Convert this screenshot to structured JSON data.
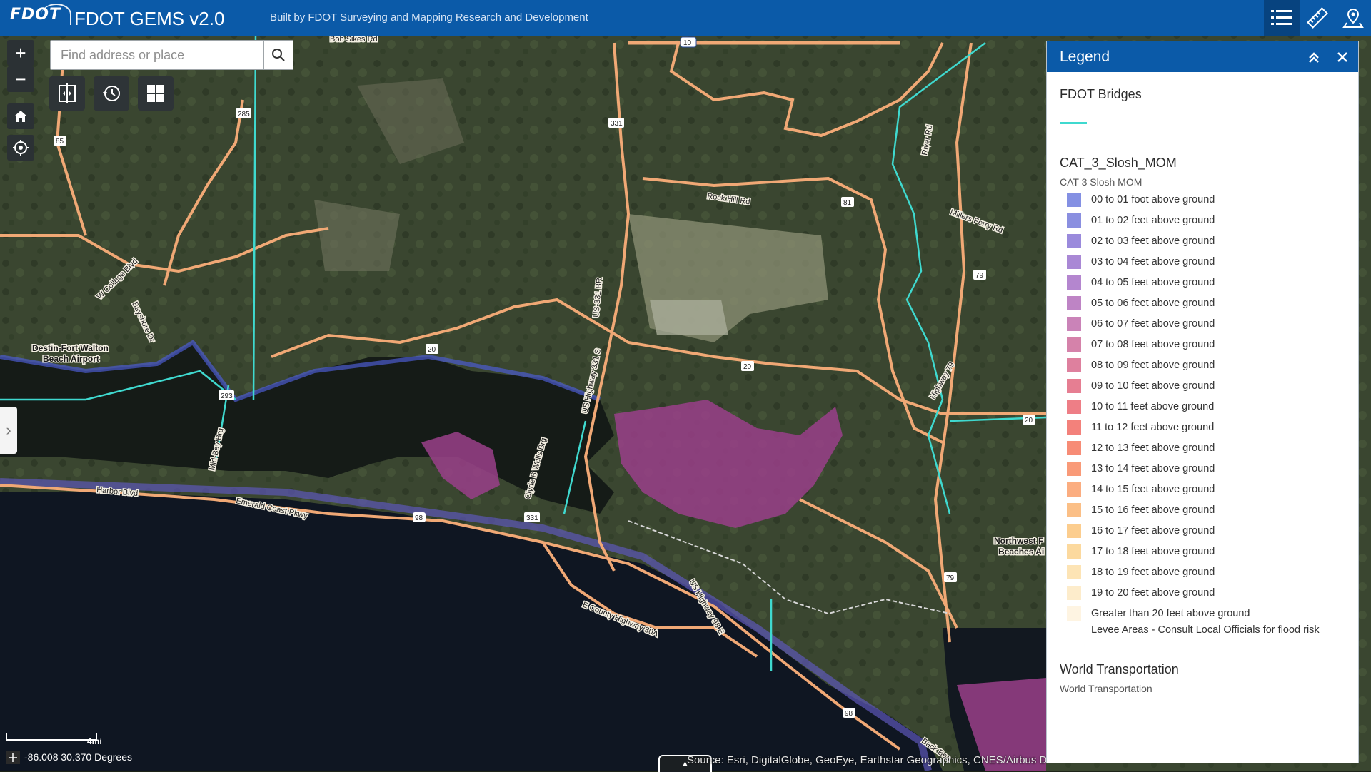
{
  "header": {
    "logo_text": "FDOT",
    "app_title": "FDOT GEMS v2.0",
    "subtitle": "Built by FDOT Surveying and Mapping Research and Development",
    "buttons": [
      {
        "name": "legend-list",
        "icon": "list-icon"
      },
      {
        "name": "measure",
        "icon": "ruler-icon"
      },
      {
        "name": "location",
        "icon": "map-pin-icon"
      }
    ]
  },
  "search": {
    "placeholder": "Find address or place"
  },
  "map_controls": {
    "zoom_in": "+",
    "zoom_out": "−",
    "home": "home-icon",
    "locate": "locate-icon",
    "tools": [
      "swipe-compare-icon",
      "history-icon",
      "basemap-gallery-icon"
    ]
  },
  "map_labels": {
    "places": [
      "Destin-Fort Walton",
      "Beach Airport",
      "Northwest F",
      "Beaches Ai"
    ],
    "roads": [
      "Bob Sikes Rd",
      "Rock Hill Rd",
      "Millers Ferry Rd",
      "River Rd",
      "US-331 BR",
      "US Highway 331 S",
      "Highway 79",
      "Mid-Bay Brg",
      "Clyde B Wells Brg",
      "Emerald Coast Pkwy",
      "Harbor Blvd",
      "E County Highway 30A",
      "US Highway 98 E",
      "W College Blvd",
      "Bayshore Dr",
      "Back Bea"
    ],
    "shields": [
      "10",
      "285",
      "85",
      "331",
      "81",
      "79",
      "20",
      "20",
      "20",
      "293",
      "98",
      "331",
      "79",
      "98"
    ]
  },
  "legend": {
    "title": "Legend",
    "layers": [
      {
        "name": "FDOT Bridges",
        "line_color": "#3fd9cf"
      },
      {
        "name": "CAT_3_Slosh_MOM",
        "subtitle": "CAT 3 Slosh MOM",
        "items": [
          {
            "label": "00 to 01 foot above ground",
            "color": "#8490e3"
          },
          {
            "label": "01 to 02 feet above ground",
            "color": "#8a8fe0"
          },
          {
            "label": "02 to 03 feet above ground",
            "color": "#9a8adc"
          },
          {
            "label": "03 to 04 feet above ground",
            "color": "#a988d5"
          },
          {
            "label": "04 to 05 feet above ground",
            "color": "#b486cf"
          },
          {
            "label": "05 to 06 feet above ground",
            "color": "#be84c5"
          },
          {
            "label": "06 to 07 feet above ground",
            "color": "#ca83b8"
          },
          {
            "label": "07 to 08 feet above ground",
            "color": "#d582aa"
          },
          {
            "label": "08 to 09 feet above ground",
            "color": "#de809e"
          },
          {
            "label": "09 to 10 feet above ground",
            "color": "#e67e92"
          },
          {
            "label": "10 to 11 feet above ground",
            "color": "#ee7e86"
          },
          {
            "label": "11 to 12 feet above ground",
            "color": "#f3817b"
          },
          {
            "label": "12 to 13 feet above ground",
            "color": "#f78c76"
          },
          {
            "label": "13 to 14 feet above ground",
            "color": "#f99a78"
          },
          {
            "label": "14 to 15 feet above ground",
            "color": "#fbad80"
          },
          {
            "label": "15 to 16 feet above ground",
            "color": "#fbbf86"
          },
          {
            "label": "16 to 17 feet above ground",
            "color": "#fccd8e"
          },
          {
            "label": "17 to 18 feet above ground",
            "color": "#fcd99e"
          },
          {
            "label": "18 to 19 feet above ground",
            "color": "#fde4b5"
          },
          {
            "label": "19 to 20 feet above ground",
            "color": "#fdeccb"
          },
          {
            "label": "Greater than 20 feet above ground",
            "color": "#fef4e2"
          },
          {
            "label": "Levee Areas - Consult Local Officials for flood risk",
            "color": "#ffffff"
          }
        ]
      },
      {
        "name": "World Transportation",
        "subtitle": "World Transportation"
      }
    ]
  },
  "status": {
    "coordinates": "-86.008 30.370 Degrees",
    "scale_label": "4mi",
    "attribution": "Source: Esri, DigitalGlobe, GeoEye, Earthstar Geographics, CNES/Airbus DS"
  },
  "colors": {
    "header_bg": "#0b5aa8",
    "water": "#121820",
    "land": "#3a4630",
    "road": "#f0a875",
    "bridge": "#3fd9cf",
    "surge": "#9a3f8a"
  }
}
